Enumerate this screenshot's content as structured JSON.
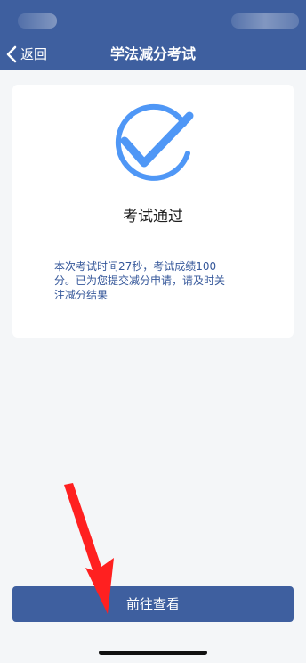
{
  "header": {
    "back_label": "返回",
    "title": "学法减分考试"
  },
  "result": {
    "title": "考试通过",
    "message": "本次考试时间27秒，考试成绩100\n分。已为您提交减分申请，请及时关\n注减分结果"
  },
  "action": {
    "goto_label": "前往查看"
  },
  "colors": {
    "brand_blue": "#3e5f9f",
    "check_blue": "#4f97f6",
    "message_blue": "#35579a",
    "annotation_red": "#ff2020"
  },
  "icons": {
    "back": "chevron-left-icon",
    "check": "check-circle-icon",
    "annotation": "red-arrow-icon"
  }
}
